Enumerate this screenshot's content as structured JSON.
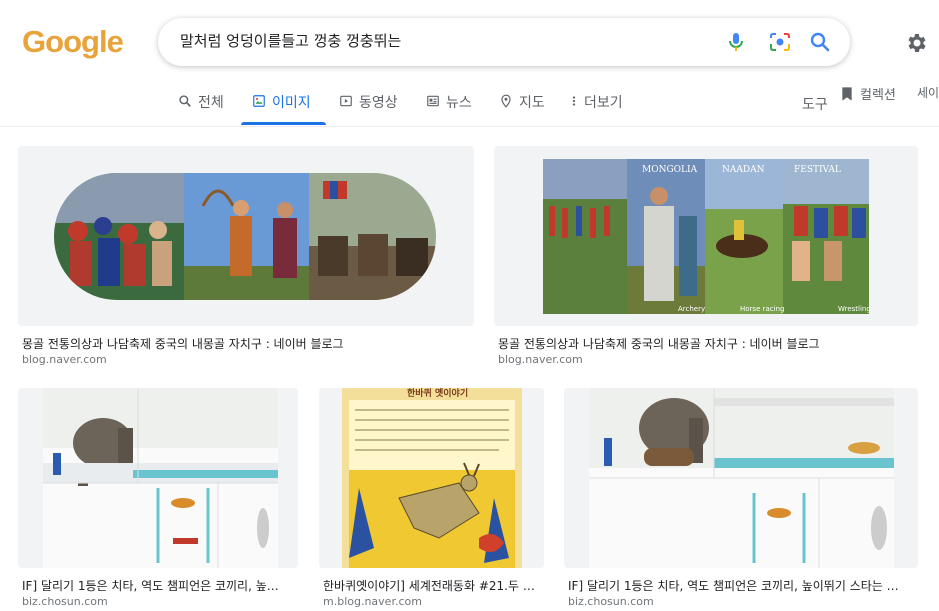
{
  "logo": {
    "text": "Google"
  },
  "search": {
    "query": "말처럼 엉덩이를들고 껑충 껑충뛰는"
  },
  "tabs": [
    {
      "label": "전체"
    },
    {
      "label": "이미지"
    },
    {
      "label": "동영상"
    },
    {
      "label": "뉴스"
    },
    {
      "label": "지도"
    },
    {
      "label": "더보기"
    }
  ],
  "tools": {
    "label": "도구"
  },
  "collections": {
    "label": "컬렉션"
  },
  "safesearch": {
    "label": "세이"
  },
  "results": [
    {
      "caption": "몽골 전통의상과 나담축제 중국의 내몽골 자치구 : 네이버 블로그",
      "source": "blog.naver.com"
    },
    {
      "caption": "몽골 전통의상과 나담축제 중국의 내몽골 자치구 : 네이버 블로그",
      "source": "blog.naver.com",
      "thumb_labels": [
        "MONGOLIA",
        "NAADAN",
        "FESTIVAL",
        "Archery",
        "Horse racing",
        "Wrestling"
      ]
    },
    {
      "caption": "IF] 달리기 1등은 치타, 역도 챔피언은 코끼리, 높…",
      "source": "biz.chosun.com"
    },
    {
      "caption": "한바퀴옛이야기] 세계전래동화 #21.두 …",
      "source": "m.blog.naver.com",
      "thumb_title": "한바퀴 옛이야기"
    },
    {
      "caption": "IF] 달리기 1등은 치타, 역도 챔피언은 코끼리, 높이뛰기 스타는 …",
      "source": "biz.chosun.com"
    }
  ],
  "colors": {
    "accent": "#1a73e8",
    "logo_blue": "#4285F4",
    "logo_red": "#EA4335",
    "logo_yellow": "#FBBC05",
    "logo_green": "#34A853"
  }
}
